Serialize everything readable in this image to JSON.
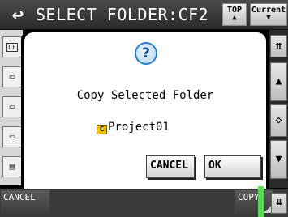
{
  "header": {
    "back_glyph": "↩",
    "title": "SELECT FOLDER:CF2",
    "top_button": {
      "label": "TOP",
      "arrow": "▲"
    },
    "current_button": {
      "label": "Current",
      "arrow": "▼"
    }
  },
  "sidebar": {
    "items": [
      {
        "icon": "sd-card-icon",
        "label": "CF"
      },
      {
        "icon": "folder-icon",
        "label": ""
      },
      {
        "icon": "folder-icon",
        "label": ""
      },
      {
        "icon": "folder-icon",
        "label": ""
      },
      {
        "icon": "file-icon",
        "label": ""
      }
    ]
  },
  "dialog": {
    "icon": "question-icon",
    "icon_glyph": "?",
    "message": "Copy Selected Folder",
    "folder_icon_letter": "C",
    "folder_name": "Project01",
    "cancel_label": "CANCEL",
    "ok_label": "OK"
  },
  "footer": {
    "cancel_label": "CANCEL",
    "copy_label": "COPY",
    "lamp_color": "#57d957"
  },
  "scroll": {
    "top_glyph": "⇈",
    "up_glyph": "▲",
    "mid_glyph": "◇",
    "down_glyph": "▼",
    "bottom_glyph": "⇊"
  }
}
